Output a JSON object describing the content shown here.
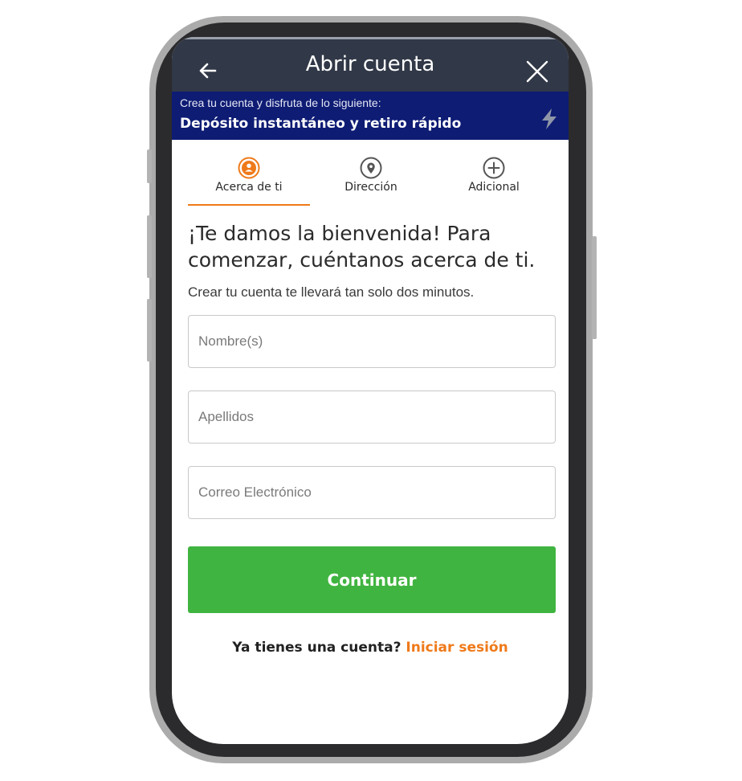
{
  "header": {
    "title": "Abrir cuenta"
  },
  "promo": {
    "subtitle": "Crea tu cuenta y disfruta de lo siguiente:",
    "headline": "Depósito instantáneo y retiro rápido"
  },
  "steps": [
    {
      "label": "Acerca de ti",
      "icon": "user-icon",
      "active": true
    },
    {
      "label": "Dirección",
      "icon": "location-pin-icon",
      "active": false
    },
    {
      "label": "Adicional",
      "icon": "plus-circle-icon",
      "active": false
    }
  ],
  "form": {
    "heading": "¡Te damos la bienvenida! Para comenzar, cuéntanos acerca de ti.",
    "subheading": "Crear tu cuenta te llevará tan solo dos minutos.",
    "first_name_placeholder": "Nombre(s)",
    "last_name_placeholder": "Apellidos",
    "email_placeholder": "Correo Electrónico",
    "submit_label": "Continuar"
  },
  "login": {
    "prompt": "Ya tienes una cuenta?",
    "link": "Iniciar sesión"
  },
  "colors": {
    "header_bg": "#313847",
    "promo_bg": "#0e1c74",
    "accent": "#ef7a1a",
    "cta": "#40b440"
  }
}
